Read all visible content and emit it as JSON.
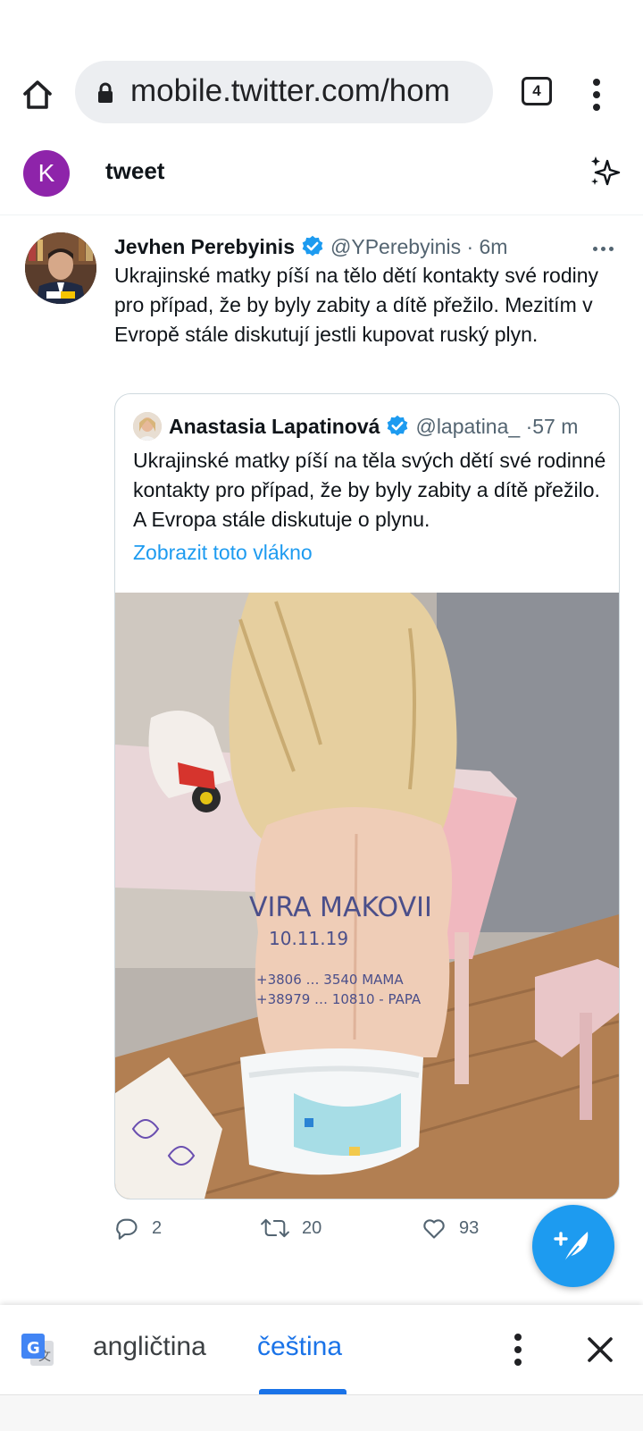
{
  "browser": {
    "url": "mobile.twitter.com/hom",
    "tab_count": "4"
  },
  "header": {
    "avatar_letter": "K",
    "title": "tweet"
  },
  "tweet": {
    "author_name": "Jevhen Perebyinis",
    "author_handle_time": "@YPerebyinis · 6m",
    "text": "Ukrajinské matky píší na tělo dětí kontakty své rodiny pro případ, že by byly zabity a dítě přežilo. Mezitím v Evropě stále diskutují jestli kupovat ruský plyn.",
    "quote": {
      "author_name": "Anastasia Lapatinová",
      "author_handle_time": "@lapatina_ ·57 m",
      "text": "Ukrajinské matky píší na těla svých dětí své rodinné kontakty pro případ, že by byly zabity a dítě přežilo. A Evropa stále diskutuje o plynu.",
      "show_thread": "Zobrazit toto vlákno",
      "photo_writing": [
        "VIRA MAKOVII",
        "10.11.19",
        "+3806 … 3540 MAMA",
        "+38979 … 10810 - PAPA"
      ]
    },
    "actions": {
      "reply_count": "2",
      "retweet_count": "20",
      "like_count": "93"
    }
  },
  "translate": {
    "source_lang": "angličtina",
    "target_lang": "čeština"
  },
  "colors": {
    "twitter_blue": "#1d9bf0",
    "avatar_purple": "#8e24aa",
    "translate_blue": "#1a73e8"
  }
}
